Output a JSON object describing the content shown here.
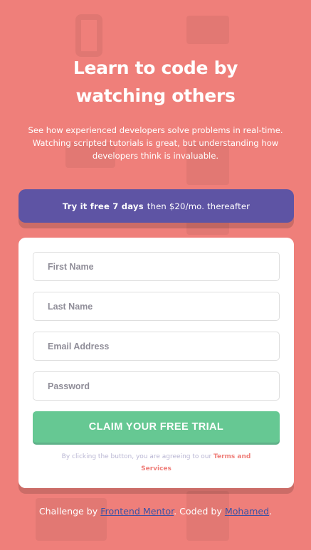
{
  "hero": {
    "title": "Learn to code by watching others",
    "description": "See how experienced developers solve problems in real-time. Watching scripted tutorials is great, but understanding how developers think is invaluable."
  },
  "promo": {
    "bold": "Try it free 7 days",
    "rest": "then $20/mo. thereafter"
  },
  "form": {
    "first_name_placeholder": "First Name",
    "last_name_placeholder": "Last Name",
    "email_placeholder": "Email Address",
    "password_placeholder": "Password",
    "submit_label": "CLAIM YOUR FREE TRIAL",
    "terms_prefix": "By clicking the button, you are agreeing to our",
    "terms_link": "Terms and Services"
  },
  "footer": {
    "prefix": "Challenge by",
    "mentor_link": "Frontend Mentor",
    "middle": ". Coded by",
    "author_link": "Mohamed",
    "suffix": "."
  },
  "colors": {
    "background": "#ef7f7a",
    "promo": "#5e54a4",
    "button": "#66c893",
    "link": "#3e52a3"
  }
}
